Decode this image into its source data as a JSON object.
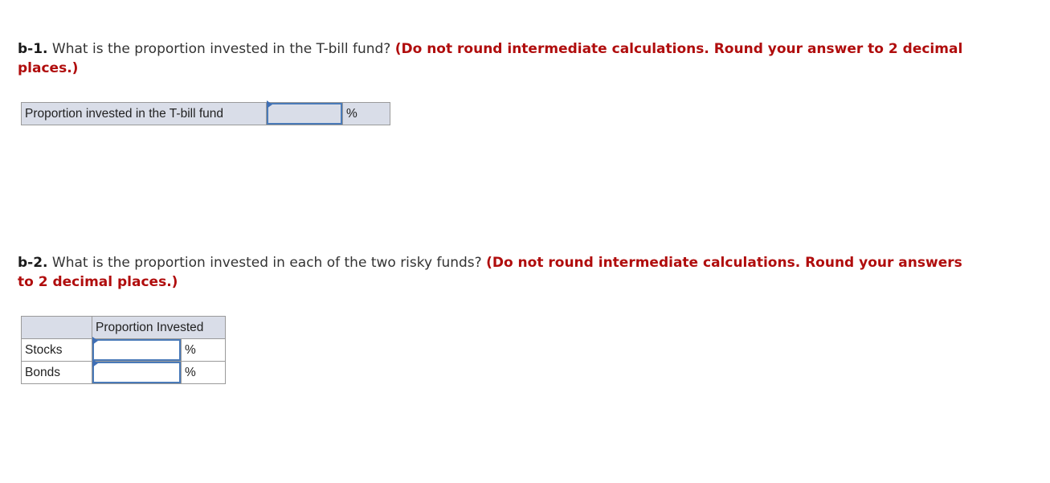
{
  "question_b1": {
    "number": "b-1.",
    "text": " What is the proportion invested in the T-bill fund? ",
    "instruction": "(Do not round intermediate calculations. Round your answer to 2 decimal places.)"
  },
  "table_b1": {
    "row_label": "Proportion invested in the T-bill fund",
    "value": "",
    "unit": "%"
  },
  "question_b2": {
    "number": "b-2.",
    "text": " What is the proportion invested in each of the two risky funds? ",
    "instruction": "(Do not round intermediate calculations. Round your answers to 2 decimal places.)"
  },
  "table_b2": {
    "column_header": "Proportion Invested",
    "rows": [
      {
        "label": "Stocks",
        "value": "",
        "unit": "%"
      },
      {
        "label": "Bonds",
        "value": "",
        "unit": "%"
      }
    ]
  }
}
